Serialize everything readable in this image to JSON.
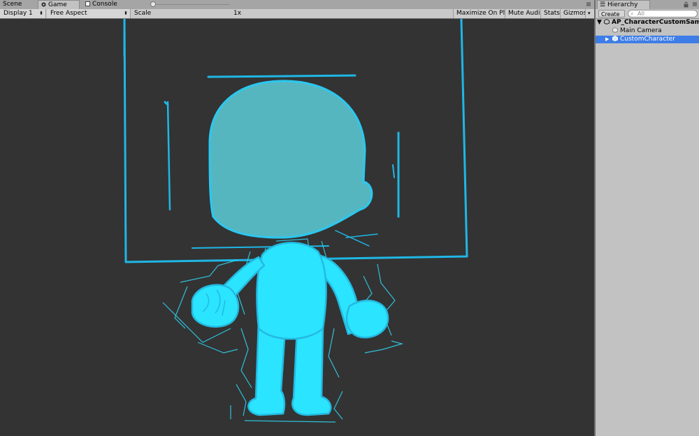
{
  "tabs": {
    "scene": "Scene",
    "game": "Game",
    "console": "Console"
  },
  "game_toolbar": {
    "display": "Display 1",
    "aspect": "Free Aspect",
    "scale_label": "Scale",
    "scale_value": "1x",
    "maximize": "Maximize On Play",
    "mute": "Mute Audio",
    "stats": "Stats",
    "gizmos": "Gizmos"
  },
  "hierarchy": {
    "title": "Hierarchy",
    "create": "Create",
    "search_placeholder": "All",
    "scene_name": "AP_CharacterCustomSam",
    "items": [
      {
        "label": "Main Camera",
        "selected": false
      },
      {
        "label": "CustomCharacter",
        "selected": true
      }
    ]
  },
  "colors": {
    "viewport_bg": "#333333",
    "character_fill": "#2be4ff",
    "head_fill": "#56b6c0",
    "outline": "#1fb7e6",
    "selection": "#3e7de7"
  }
}
